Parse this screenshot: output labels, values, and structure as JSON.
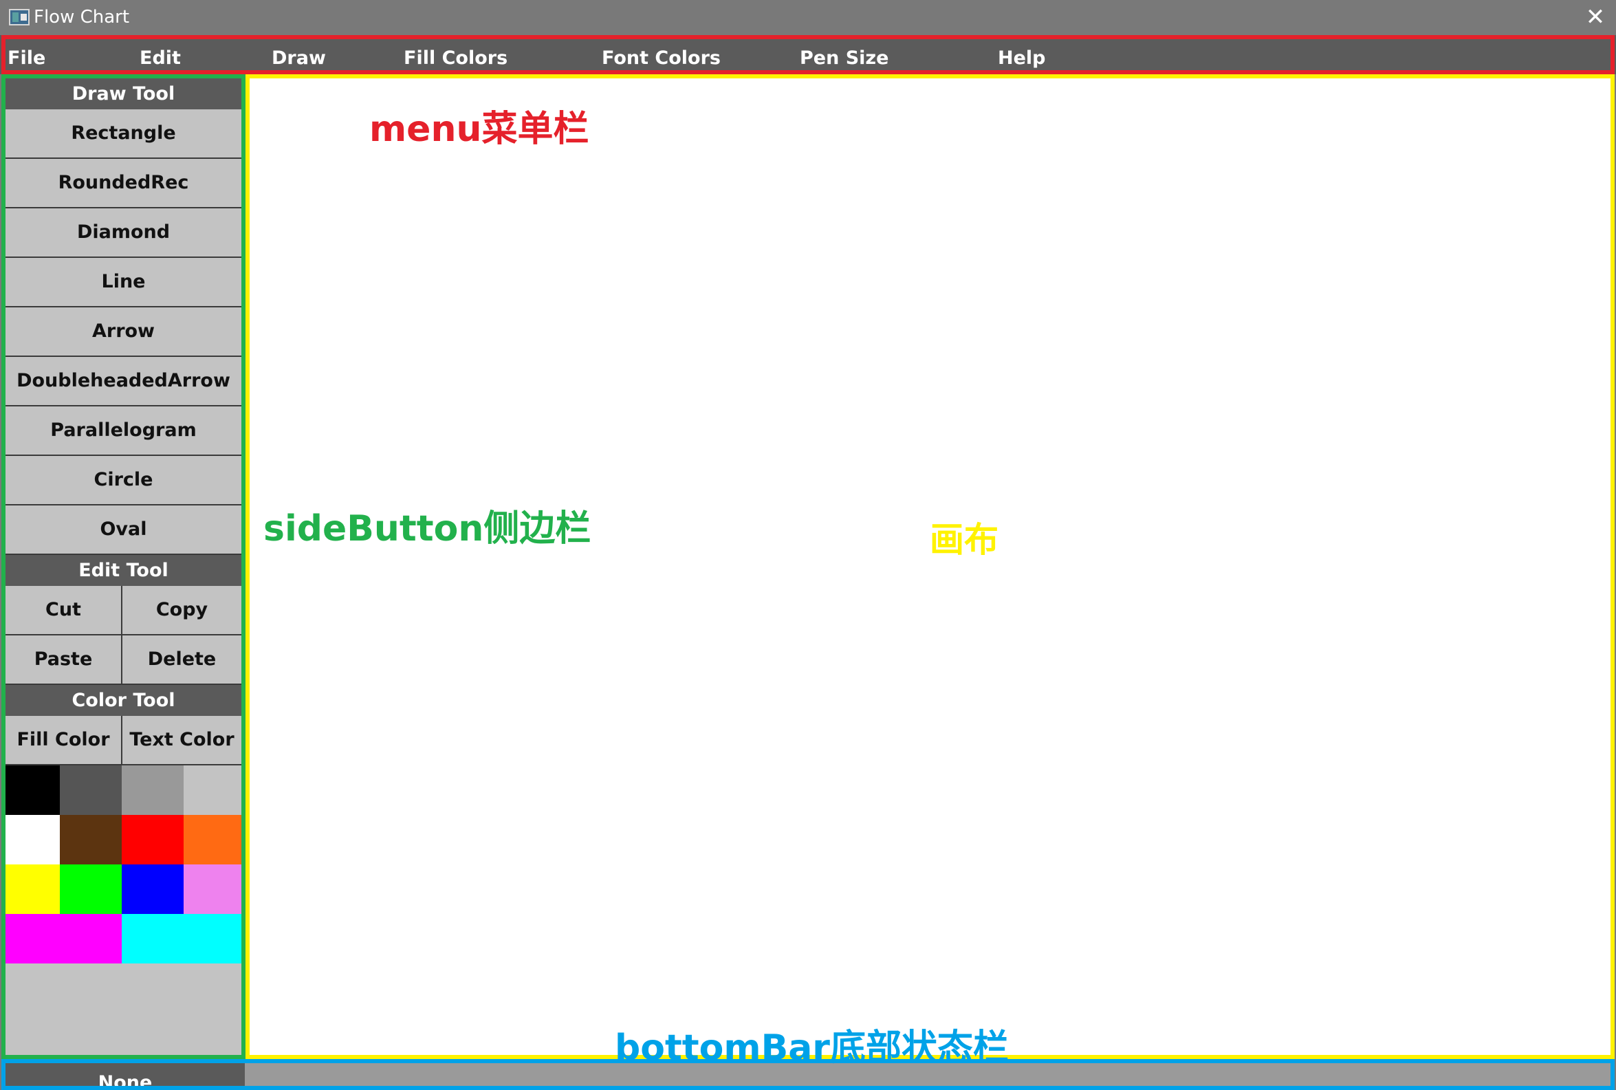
{
  "window": {
    "title": "Flow Chart",
    "close_glyph": "✕",
    "app_icon": "app-window-icon",
    "close_icon": "close-icon"
  },
  "menu": {
    "items": [
      "File",
      "Edit",
      "Draw",
      "Fill Colors",
      "Font Colors",
      "Pen Size",
      "Help"
    ]
  },
  "sidebar": {
    "draw_tool_header": "Draw Tool",
    "draw_tools": [
      "Rectangle",
      "RoundedRec",
      "Diamond",
      "Line",
      "Arrow",
      "DoubleheadedArrow",
      "Parallelogram",
      "Circle",
      "Oval"
    ],
    "edit_tool_header": "Edit Tool",
    "edit_tools": [
      "Cut",
      "Copy",
      "Paste",
      "Delete"
    ],
    "color_tool_header": "Color Tool",
    "color_tools": [
      "Fill Color",
      "Text Color"
    ],
    "palette": [
      "#000000",
      "#555555",
      "#999999",
      "#c3c3c3",
      "#ffffff",
      "#5c3410",
      "#ff0000",
      "#ff6a13",
      "#ffff00",
      "#00ff00",
      "#0000ff",
      "#ee82ee",
      "#ff00ff",
      "#00ffff"
    ]
  },
  "status": {
    "mode": "None"
  },
  "annotations": {
    "menu": {
      "text": "menu菜单栏",
      "color": "#e5212b"
    },
    "sidebar": {
      "text": "sideButton侧边栏",
      "color": "#22b14c"
    },
    "canvas": {
      "text": "画布",
      "color": "#fff200"
    },
    "bottombar": {
      "text": "bottomBar底部状态栏",
      "color": "#00a2e8"
    }
  },
  "frame_colors": {
    "menu": "#e5212b",
    "sidebar": "#22b14c",
    "canvas": "#fff200",
    "bottombar": "#00a2e8"
  }
}
